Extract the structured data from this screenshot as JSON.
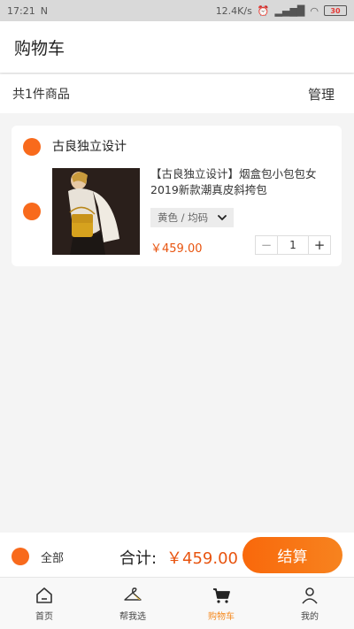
{
  "status_bar": {
    "time": "17:21",
    "network_speed": "12.4K/s",
    "battery": "30"
  },
  "header": {
    "title": "购物车"
  },
  "summary": {
    "count_text": "共1件商品",
    "manage_label": "管理"
  },
  "cart": {
    "shop_name": "古良独立设计",
    "item": {
      "title": "【古良独立设计】烟盒包小包包女2019新款潮真皮斜挎包",
      "variant": "黄色 / 均码",
      "price": "￥459.00",
      "quantity": "1",
      "minus": "−",
      "plus": "+"
    }
  },
  "checkout": {
    "select_all_label": "全部",
    "total_label": "合计:",
    "total_amount": "￥459.00",
    "button_label": "结算"
  },
  "tabs": [
    {
      "label": "首页",
      "icon": "home-icon"
    },
    {
      "label": "帮我选",
      "icon": "hanger-icon"
    },
    {
      "label": "购物车",
      "icon": "cart-icon",
      "active": true
    },
    {
      "label": "我的",
      "icon": "profile-icon"
    }
  ],
  "colors": {
    "accent": "#f86a1c",
    "price": "#e8540f",
    "active_tab": "#f58a1f"
  }
}
